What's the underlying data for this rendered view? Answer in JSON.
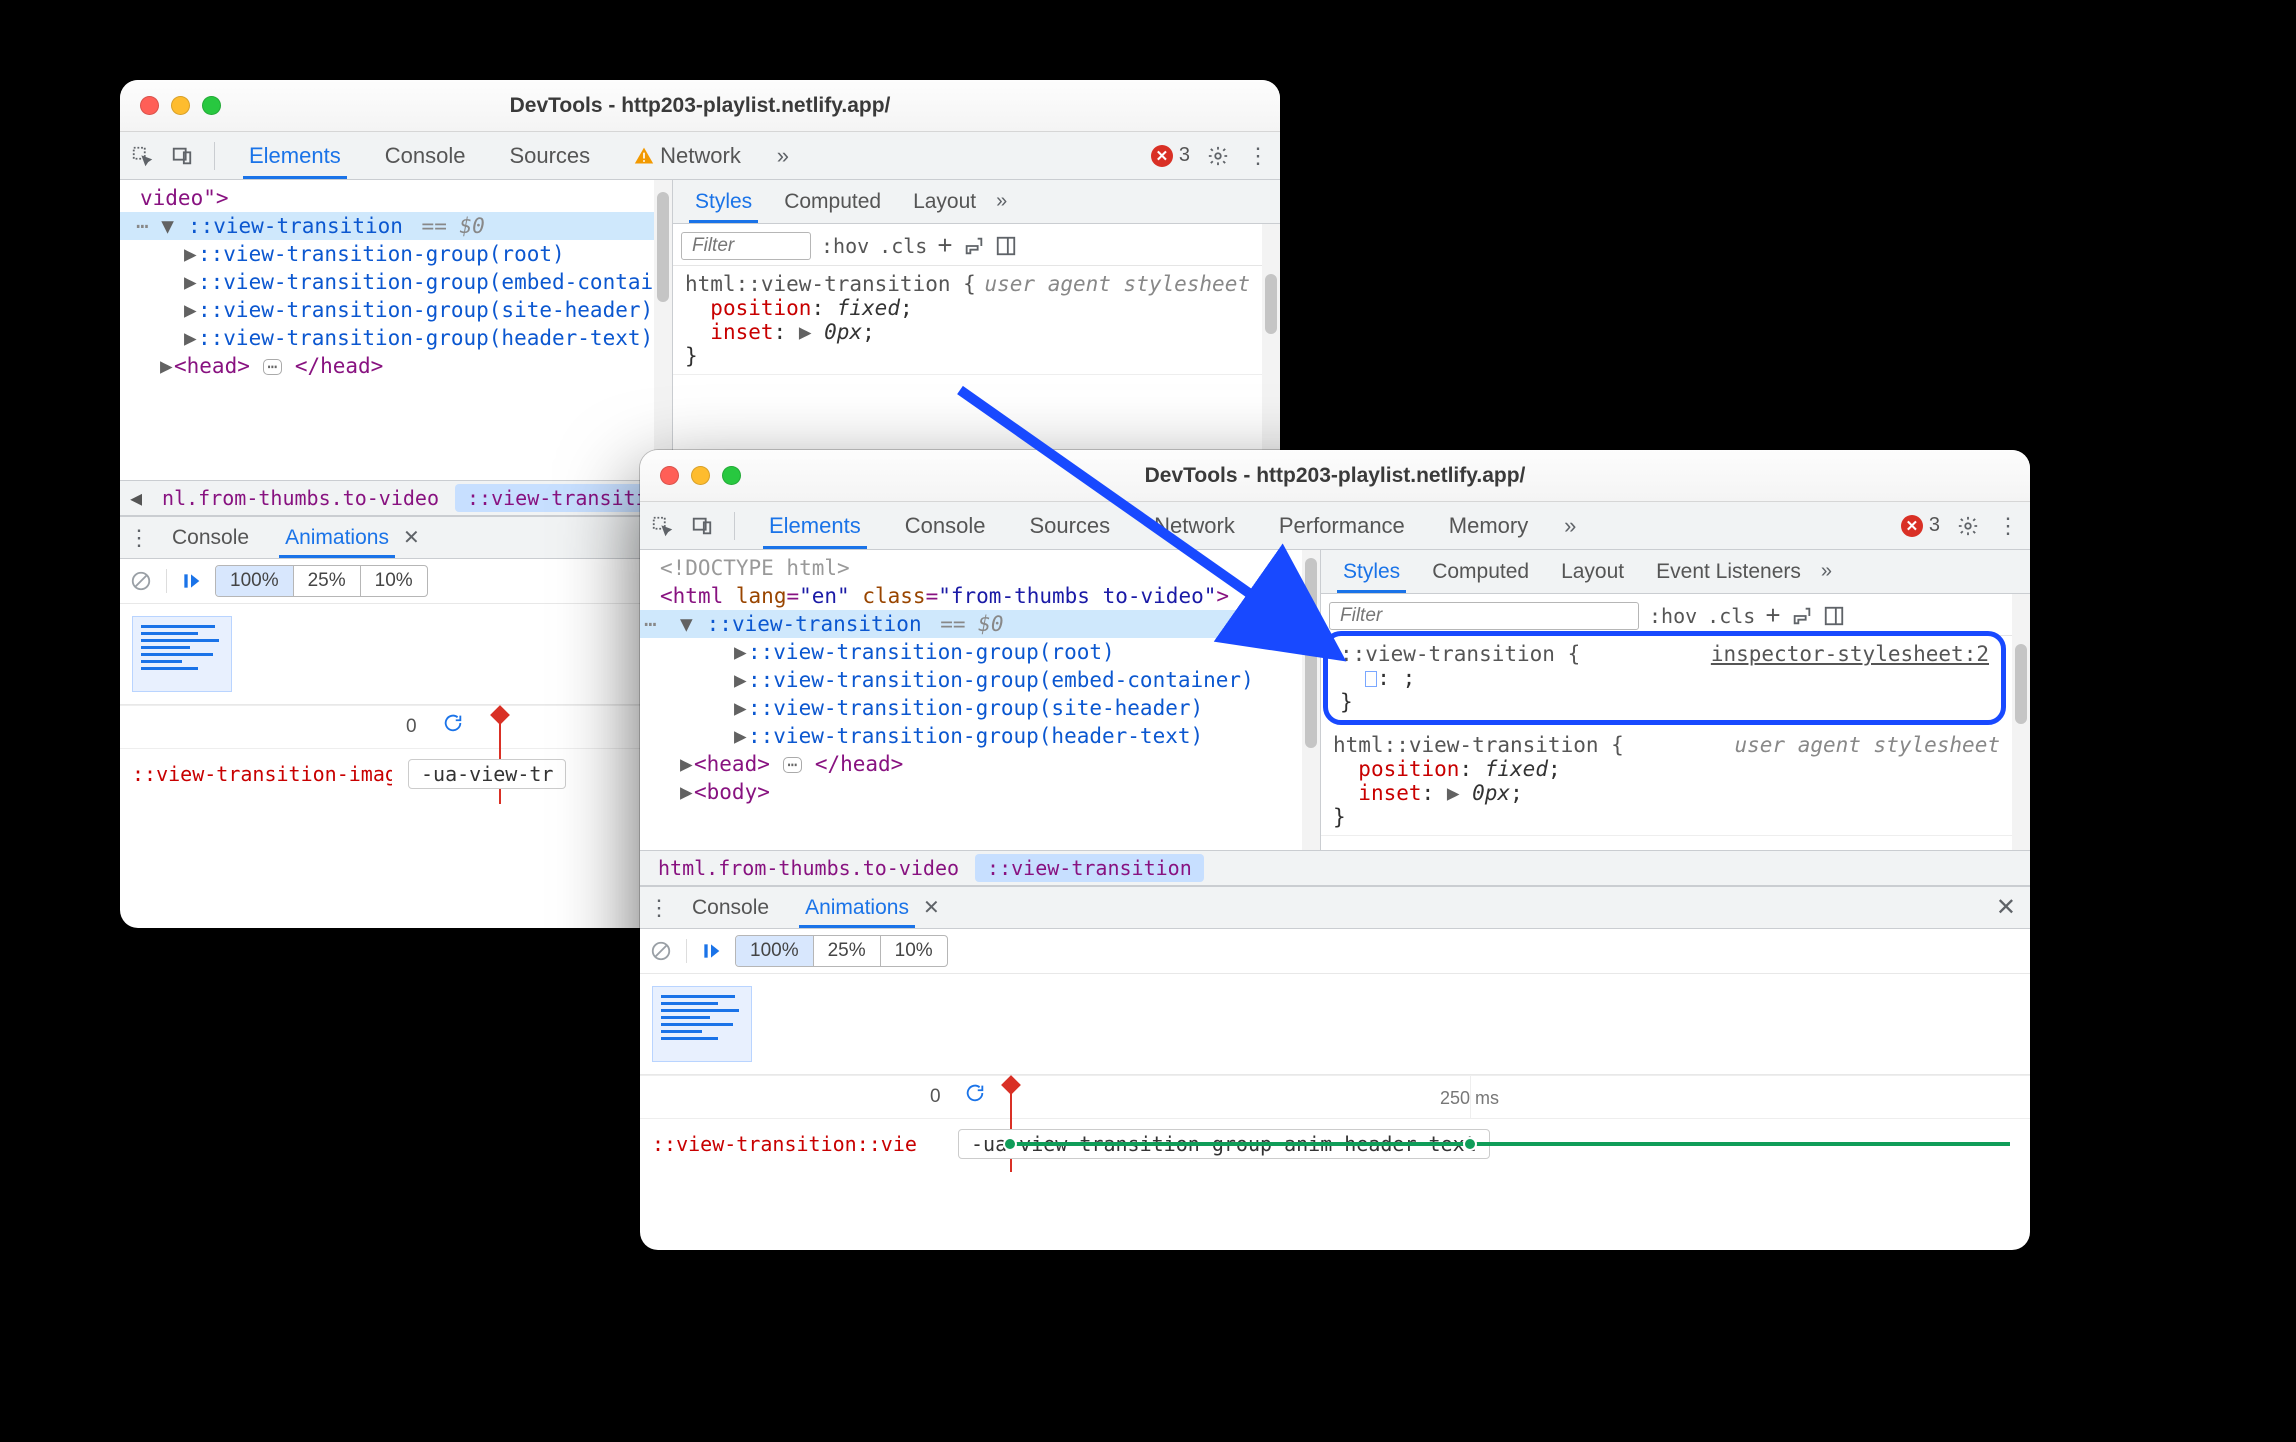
{
  "windows": {
    "a": {
      "title": "DevTools - http203-playlist.netlify.app/"
    },
    "b": {
      "title": "DevTools - http203-playlist.netlify.app/"
    }
  },
  "tabs_main": {
    "elements": "Elements",
    "console": "Console",
    "sources": "Sources",
    "network": "Network",
    "performance": "Performance",
    "memory": "Memory"
  },
  "errors": {
    "count": "3"
  },
  "tree_a": {
    "video_close": "video\">",
    "vt": "::view-transition",
    "eq0": "== $0",
    "g_root": "::view-transition-group(root)",
    "g_embed": "::view-transition-group(embed-container)",
    "g_site": "::view-transition-group(site-header)",
    "g_header": "::view-transition-group(header-text)",
    "head_open": "<head>",
    "head_close": "</head>"
  },
  "tree_b": {
    "doctype": "<!DOCTYPE html>",
    "html_open_tag": "html",
    "html_attr_lang_n": "lang",
    "html_attr_lang_v": "\"en\"",
    "html_attr_class_n": "class",
    "html_attr_class_v": "\"from-thumbs to-video\"",
    "vt": "::view-transition",
    "eq0": "== $0",
    "g_root": "::view-transition-group(root)",
    "g_embed": "::view-transition-group(embed-container)",
    "g_site": "::view-transition-group(site-header)",
    "g_header": "::view-transition-group(header-text)",
    "head_open": "<head>",
    "head_close": "</head>",
    "body": "<body>"
  },
  "crumbs_a": {
    "left": "nl.from-thumbs.to-video",
    "sel": "::view-transition"
  },
  "crumbs_b": {
    "left": "html.from-thumbs.to-video",
    "sel": "::view-transition"
  },
  "styles": {
    "tabs": {
      "styles": "Styles",
      "computed": "Computed",
      "layout": "Layout",
      "ev": "Event Listeners"
    },
    "filter_placeholder": "Filter",
    "hov": ":hov",
    "cls": ".cls",
    "ua": "user agent stylesheet",
    "rule1_sel": "html::view-transition {",
    "rule1_p1n": "position",
    "rule1_p1v": "fixed",
    "rule1_p2n": "inset",
    "rule1_p2v": "0px",
    "brace_close": "}",
    "rule_ins_sel": "::view-transition {",
    "rule_ins_src": "inspector-stylesheet:2",
    "rule_ins_body": ": ;"
  },
  "drawer": {
    "console": "Console",
    "animations": "Animations",
    "speeds": {
      "s100": "100%",
      "s25": "25%",
      "s10": "10%"
    },
    "zero": "0",
    "ms250": "250 ms",
    "row_a_name": "::view-transition-imag",
    "row_a_desc": "-ua-view-tr",
    "row_b_name": "::view-transition::vie",
    "row_b_desc": "-ua-view-transition-group-anim-header-text"
  }
}
